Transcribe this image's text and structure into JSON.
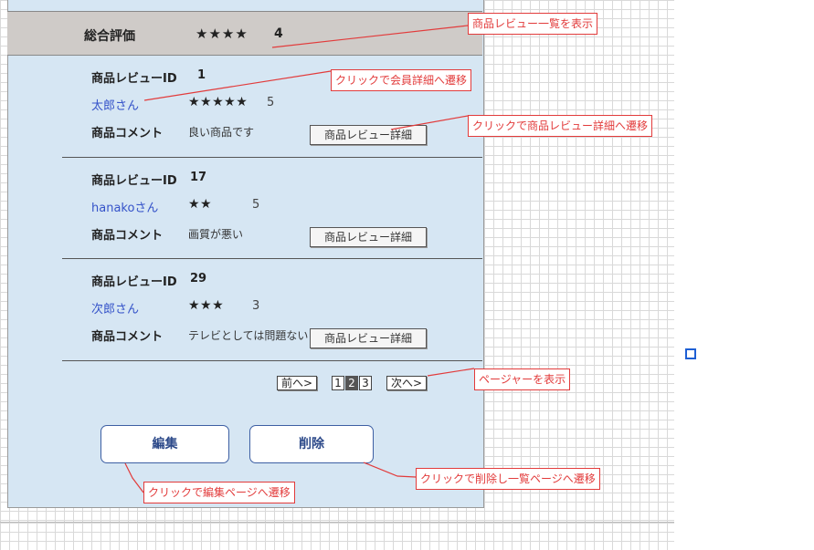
{
  "overall": {
    "label": "総合評価",
    "stars": "★★★★",
    "value": "4"
  },
  "reviews": [
    {
      "id_label": "商品レビューID",
      "id": "1",
      "name": "太郎さん",
      "stars": "★★★★★",
      "score": "5",
      "comment_label": "商品コメント",
      "comment": "良い商品です",
      "detail_label": "商品レビュー詳細"
    },
    {
      "id_label": "商品レビューID",
      "id": "17",
      "name": "hanakoさん",
      "stars": "★★",
      "score": "5",
      "comment_label": "商品コメント",
      "comment": "画質が悪い",
      "detail_label": "商品レビュー詳細"
    },
    {
      "id_label": "商品レビューID",
      "id": "29",
      "name": "次郎さん",
      "stars": "★★★",
      "score": "3",
      "comment_label": "商品コメント",
      "comment": "テレビとしては問題ない",
      "detail_label": "商品レビュー詳細"
    }
  ],
  "pager": {
    "prev": "前へ>",
    "pages": [
      "1",
      "2",
      "3"
    ],
    "current": "2",
    "next": "次へ>"
  },
  "actions": {
    "edit": "編集",
    "delete": "削除"
  },
  "annotations": {
    "list": "商品レビュー一覧を表示",
    "member": "クリックで会員詳細へ遷移",
    "detail": "クリックで商品レビュー詳細へ遷移",
    "pager": "ページャーを表示",
    "edit": "クリックで編集ページへ遷移",
    "delete": "クリックで削除し一覧ページへ遷移"
  },
  "colors": {
    "annotation": "#e23b3b",
    "link": "#3553c9",
    "panel": "#d6e6f3",
    "header": "#cfcbc8"
  }
}
